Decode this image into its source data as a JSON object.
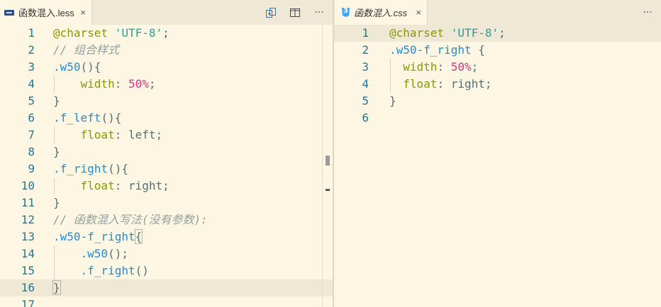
{
  "left": {
    "tab": {
      "name": "函数混入.less",
      "close": "×",
      "icon": "less-file-icon"
    },
    "actions": {
      "compare": "compare-icon",
      "split": "split-editor-icon",
      "more": "···"
    },
    "lines": [
      {
        "num": "1",
        "tokens": [
          [
            "at",
            "@charset"
          ],
          [
            "pun",
            " "
          ],
          [
            "str",
            "'UTF-8'"
          ],
          [
            "pun",
            ";"
          ]
        ]
      },
      {
        "num": "2",
        "tokens": [
          [
            "cmt",
            "// 组合样式"
          ]
        ]
      },
      {
        "num": "3",
        "tokens": [
          [
            "sel",
            ".w50"
          ],
          [
            "pun",
            "(){"
          ]
        ]
      },
      {
        "num": "4",
        "indent": true,
        "tokens": [
          [
            "pun",
            "    "
          ],
          [
            "prop",
            "width"
          ],
          [
            "pun",
            ": "
          ],
          [
            "num",
            "50%"
          ],
          [
            "pun",
            ";"
          ]
        ]
      },
      {
        "num": "5",
        "tokens": [
          [
            "pun",
            "}"
          ]
        ]
      },
      {
        "num": "6",
        "tokens": [
          [
            "sel",
            ".f_left"
          ],
          [
            "pun",
            "(){"
          ]
        ]
      },
      {
        "num": "7",
        "indent": true,
        "tokens": [
          [
            "pun",
            "    "
          ],
          [
            "prop",
            "float"
          ],
          [
            "pun",
            ": "
          ],
          [
            "val",
            "left"
          ],
          [
            "pun",
            ";"
          ]
        ]
      },
      {
        "num": "8",
        "tokens": [
          [
            "pun",
            "}"
          ]
        ]
      },
      {
        "num": "9",
        "tokens": [
          [
            "sel",
            ".f_right"
          ],
          [
            "pun",
            "(){"
          ]
        ]
      },
      {
        "num": "10",
        "indent": true,
        "tokens": [
          [
            "pun",
            "    "
          ],
          [
            "prop",
            "float"
          ],
          [
            "pun",
            ": "
          ],
          [
            "val",
            "right"
          ],
          [
            "pun",
            ";"
          ]
        ]
      },
      {
        "num": "11",
        "tokens": [
          [
            "pun",
            "}"
          ]
        ]
      },
      {
        "num": "12",
        "tokens": [
          [
            "cmt",
            "// 函数混入写法(没有参数):"
          ]
        ]
      },
      {
        "num": "13",
        "tokens": [
          [
            "sel",
            ".w50-f_right"
          ],
          [
            "hl",
            "{"
          ]
        ]
      },
      {
        "num": "14",
        "indent": true,
        "tokens": [
          [
            "pun",
            "    "
          ],
          [
            "sel",
            ".w50"
          ],
          [
            "pun",
            "();"
          ]
        ]
      },
      {
        "num": "15",
        "indent": true,
        "tokens": [
          [
            "pun",
            "    "
          ],
          [
            "sel",
            ".f_right"
          ],
          [
            "pun",
            "()"
          ]
        ]
      },
      {
        "num": "16",
        "current": true,
        "tokens": [
          [
            "hl",
            "}"
          ]
        ]
      },
      {
        "num": "17",
        "tokens": []
      }
    ]
  },
  "right": {
    "tab": {
      "name": "函数混入.css",
      "close": "×",
      "icon": "css-file-icon"
    },
    "actions": {
      "more": "···"
    },
    "lines": [
      {
        "num": "1",
        "current": true,
        "tokens": [
          [
            "at",
            "@charset"
          ],
          [
            "pun",
            " "
          ],
          [
            "str",
            "'UTF-8'"
          ],
          [
            "pun",
            ";"
          ]
        ]
      },
      {
        "num": "2",
        "tokens": [
          [
            "sel",
            ".w50-f_right"
          ],
          [
            "pun",
            " {"
          ]
        ]
      },
      {
        "num": "3",
        "indent": true,
        "tokens": [
          [
            "pun",
            "  "
          ],
          [
            "prop",
            "width"
          ],
          [
            "pun",
            ": "
          ],
          [
            "num",
            "50%"
          ],
          [
            "pun",
            ";"
          ]
        ]
      },
      {
        "num": "4",
        "indent": true,
        "tokens": [
          [
            "pun",
            "  "
          ],
          [
            "prop",
            "float"
          ],
          [
            "pun",
            ": "
          ],
          [
            "val",
            "right"
          ],
          [
            "pun",
            ";"
          ]
        ]
      },
      {
        "num": "5",
        "tokens": [
          [
            "pun",
            "}"
          ]
        ]
      },
      {
        "num": "6",
        "tokens": []
      }
    ]
  }
}
